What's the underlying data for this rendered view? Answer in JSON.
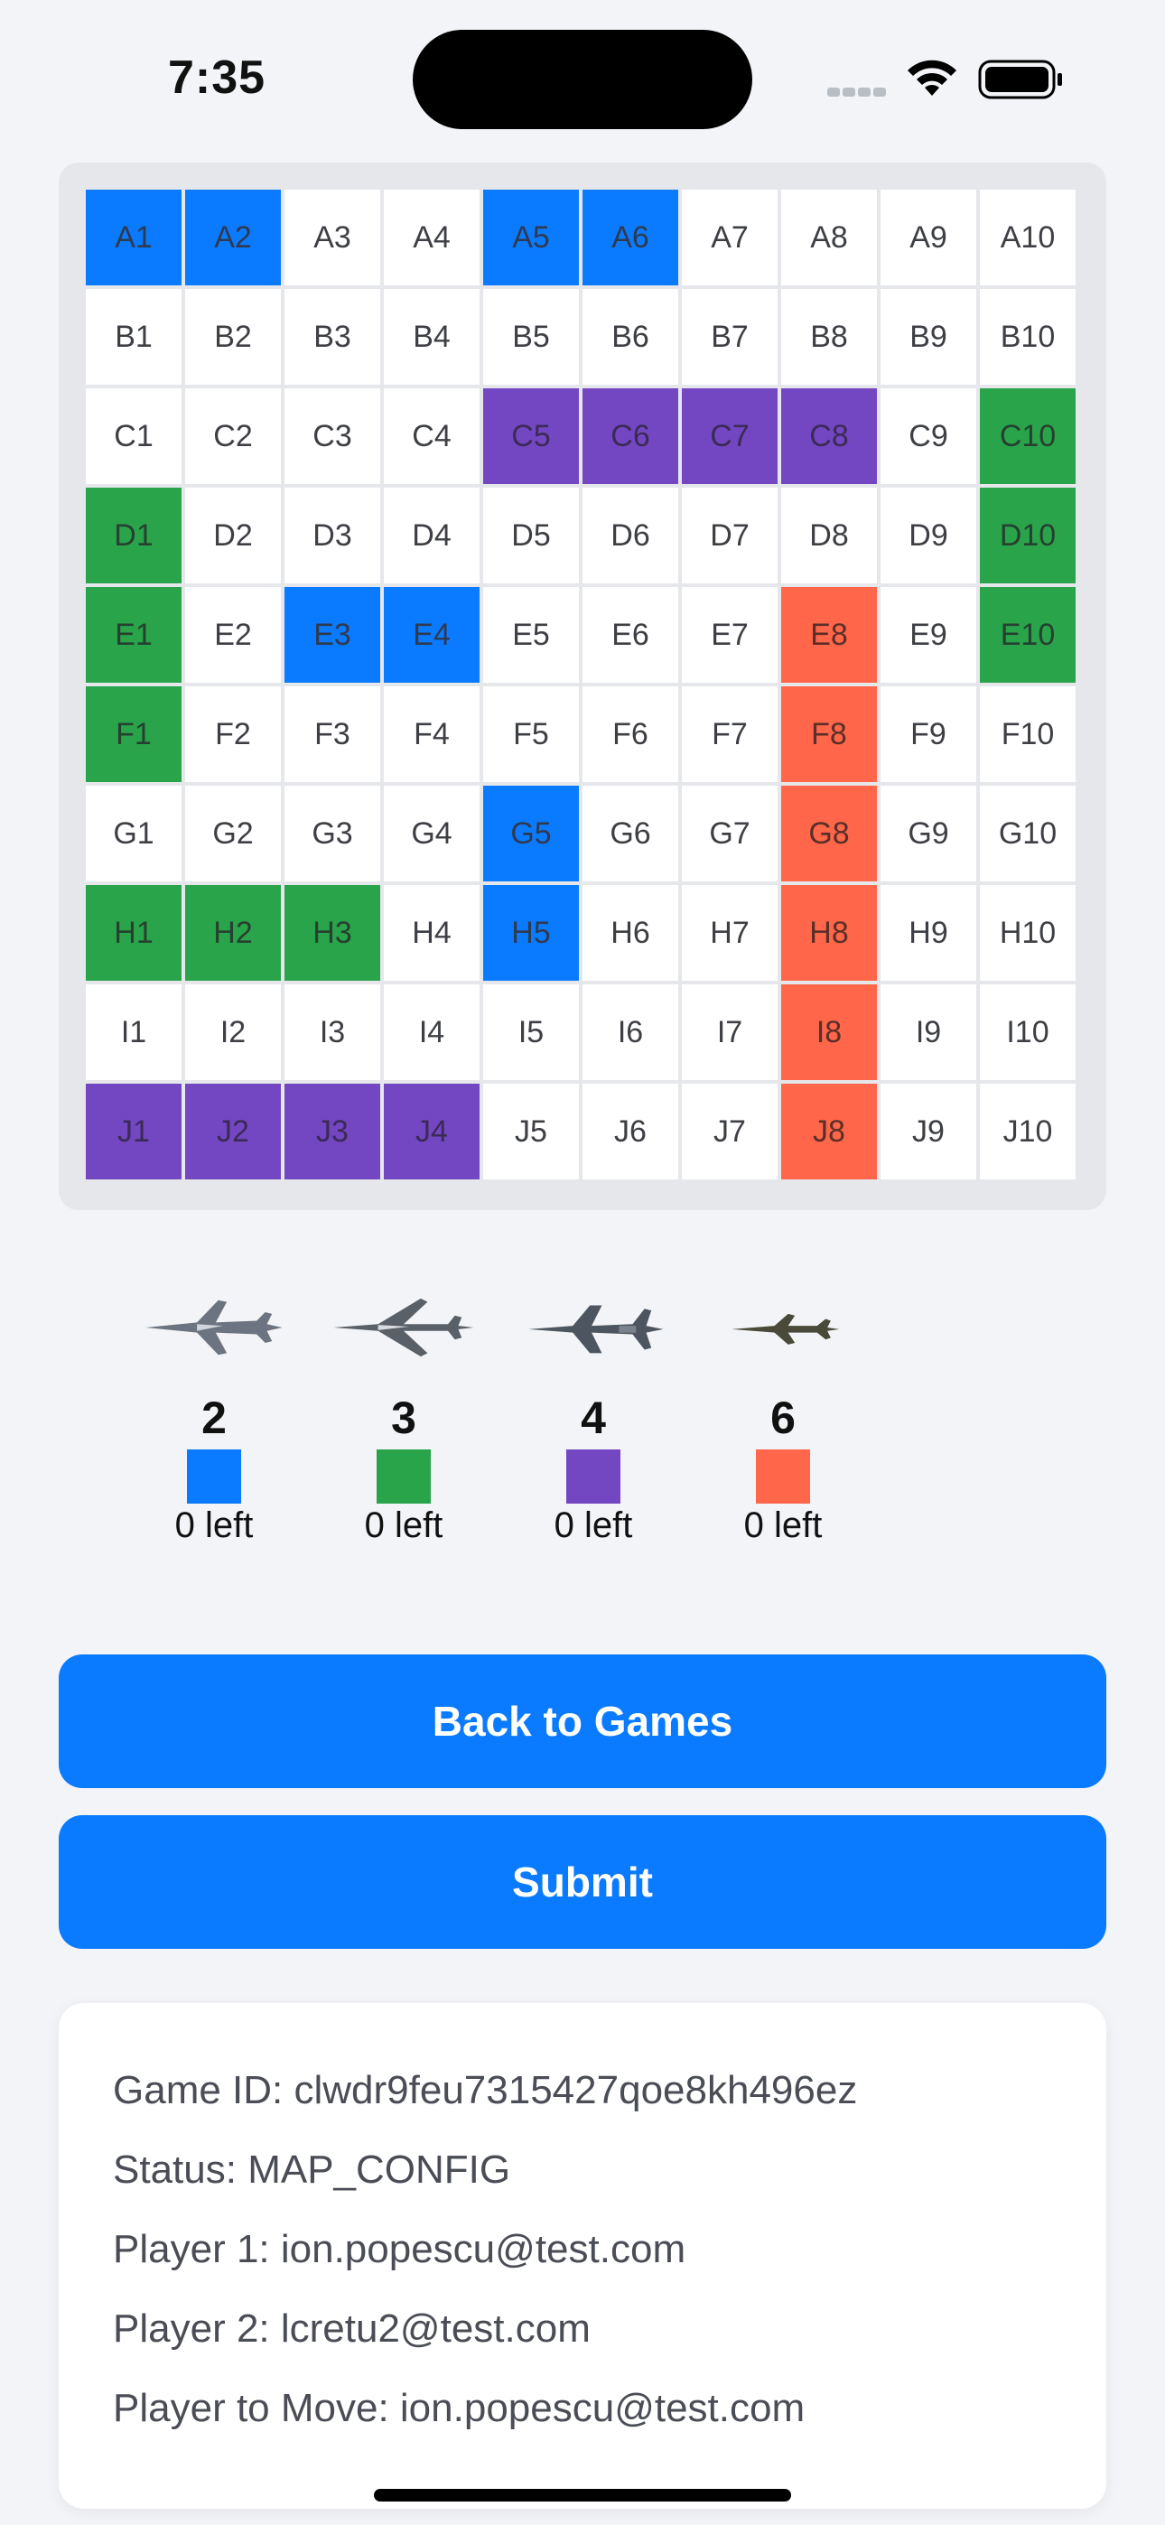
{
  "status_bar": {
    "time": "7:35"
  },
  "board": {
    "rows": [
      "A",
      "B",
      "C",
      "D",
      "E",
      "F",
      "G",
      "H",
      "I",
      "J"
    ],
    "cols": [
      "1",
      "2",
      "3",
      "4",
      "5",
      "6",
      "7",
      "8",
      "9",
      "10"
    ],
    "colors": {
      "blue": "#0a7bff",
      "green": "#2aa44a",
      "purple": "#7347c2",
      "orange": "#ff664a"
    },
    "placements": {
      "A1": "blue",
      "A2": "blue",
      "A5": "blue",
      "A6": "blue",
      "C5": "purple",
      "C6": "purple",
      "C7": "purple",
      "C8": "purple",
      "C10": "green",
      "D1": "green",
      "D10": "green",
      "E1": "green",
      "E3": "blue",
      "E4": "blue",
      "E8": "orange",
      "E10": "green",
      "F1": "green",
      "F8": "orange",
      "G5": "blue",
      "G8": "orange",
      "H1": "green",
      "H2": "green",
      "H3": "green",
      "H5": "blue",
      "H8": "orange",
      "I8": "orange",
      "J1": "purple",
      "J2": "purple",
      "J3": "purple",
      "J4": "purple",
      "J8": "orange"
    }
  },
  "legend": [
    {
      "size": "2",
      "color": "#0a7bff",
      "left": "0 left",
      "icon": "jet-fighter-icon"
    },
    {
      "size": "3",
      "color": "#2aa44a",
      "left": "0 left",
      "icon": "jet-fighter-icon"
    },
    {
      "size": "4",
      "color": "#7347c2",
      "left": "0 left",
      "icon": "jet-fighter-icon"
    },
    {
      "size": "6",
      "color": "#ff664a",
      "left": "0 left",
      "icon": "jet-fighter-icon"
    }
  ],
  "buttons": {
    "back": "Back to Games",
    "submit": "Submit"
  },
  "info": {
    "game_id": "Game ID: clwdr9feu7315427qoe8kh496ez",
    "status": "Status: MAP_CONFIG",
    "player1": "Player 1: ion.popescu@test.com",
    "player2": "Player 2: lcretu2@test.com",
    "player_to_move": "Player to Move: ion.popescu@test.com"
  }
}
